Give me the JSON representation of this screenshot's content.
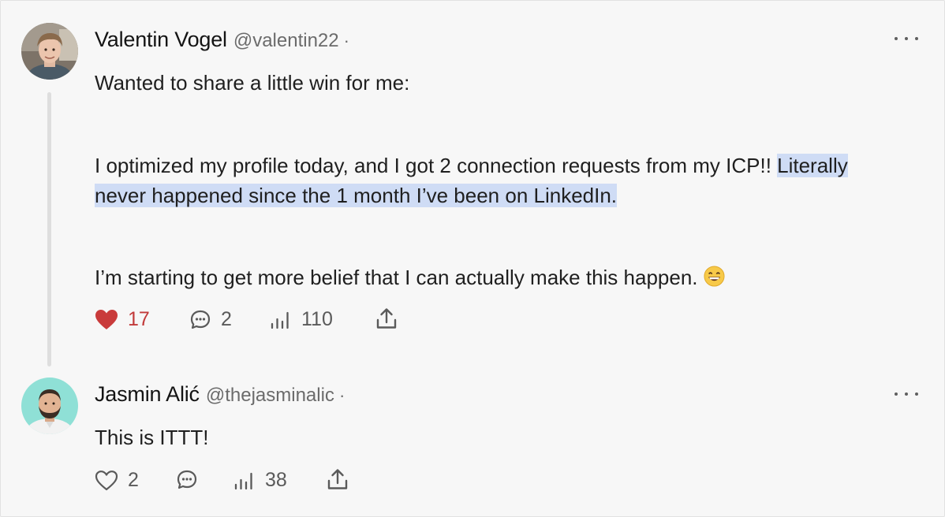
{
  "post": {
    "author_name": "Valentin Vogel",
    "handle": "@valentin22",
    "separator": "·",
    "line1": "Wanted to share a little win for me:",
    "line2_plain": "I optimized my profile today, and I got 2 connection requests from my ICP!! ",
    "line2_highlight_a": "Literally",
    "line2_highlight_b": "never happened since the 1 month I’ve been on LinkedIn.",
    "line3": "I’m starting to get more belief that I can actually make this happen. ",
    "likes": "17",
    "comments": "2",
    "views": "110",
    "liked": true,
    "like_color": "#c23a3a"
  },
  "reply": {
    "author_name": "Jasmin Alić",
    "handle": "@thejasminalic",
    "separator": "·",
    "text": "This is ITTT!",
    "likes": "2",
    "views": "38"
  },
  "icons": {
    "like": "heart-icon",
    "comment": "comment-bubble-icon",
    "views": "bar-chart-icon",
    "share": "share-upload-icon",
    "more": "more-horizontal-icon",
    "emoji": "grinning-face-emoji"
  }
}
